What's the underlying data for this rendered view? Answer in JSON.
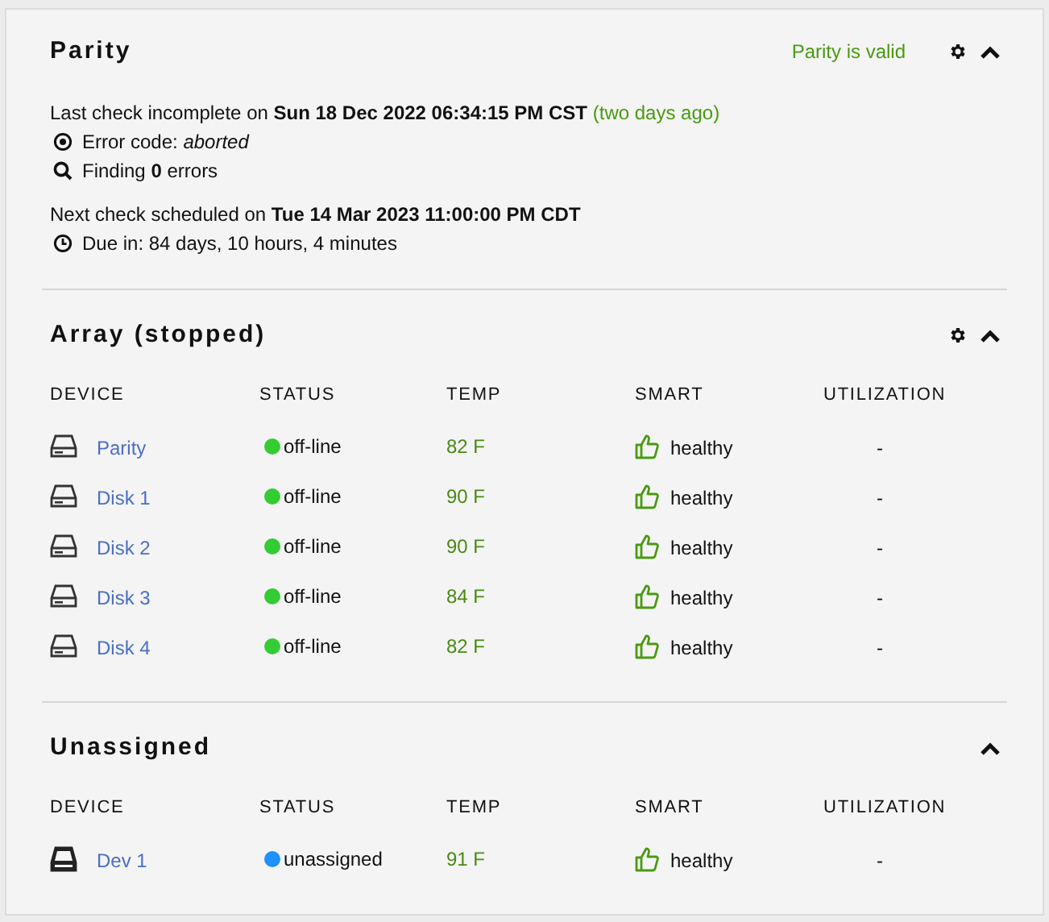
{
  "parity": {
    "title": "Parity",
    "status": "Parity is valid",
    "settings": true,
    "expanded": true,
    "last_check": "Last check incomplete on **Sun 18 Dec 2022 06:34:15 PM CST**",
    "last_check_ago": "(two days ago)",
    "error_code": "Error code: *aborted*",
    "finding": "Finding **0** errors",
    "next_check": "Next check scheduled on **Tue 14 Mar 2023 11:00:00 PM CDT**",
    "due": "Due in: 84 days, 10 hours, 4 minutes"
  },
  "sections": [
    {
      "title": "Array (stopped)",
      "settings": true,
      "expanded": true,
      "columns": [
        "DEVICE",
        "STATUS",
        "TEMP",
        "SMART",
        "UTILIZATION"
      ],
      "rows": [
        {
          "kind": "disk",
          "device": "Parity",
          "status": "off-line",
          "color": "#33cc33",
          "temp": "82 F",
          "smart": "healthy",
          "utilization": "-"
        },
        {
          "kind": "disk",
          "device": "Disk 1",
          "status": "off-line",
          "color": "#33cc33",
          "temp": "90 F",
          "smart": "healthy",
          "utilization": "-"
        },
        {
          "kind": "disk",
          "device": "Disk 2",
          "status": "off-line",
          "color": "#33cc33",
          "temp": "90 F",
          "smart": "healthy",
          "utilization": "-"
        },
        {
          "kind": "disk",
          "device": "Disk 3",
          "status": "off-line",
          "color": "#33cc33",
          "temp": "84 F",
          "smart": "healthy",
          "utilization": "-"
        },
        {
          "kind": "disk",
          "device": "Disk 4",
          "status": "off-line",
          "color": "#33cc33",
          "temp": "82 F",
          "smart": "healthy",
          "utilization": "-"
        }
      ]
    },
    {
      "title": "Unassigned",
      "settings": false,
      "expanded": true,
      "columns": [
        "DEVICE",
        "STATUS",
        "TEMP",
        "SMART",
        "UTILIZATION"
      ],
      "rows": [
        {
          "kind": "device",
          "device": "Dev 1",
          "status": "unassigned",
          "color": "#1e90ff",
          "temp": "91 F",
          "smart": "healthy",
          "utilization": "-"
        }
      ]
    }
  ]
}
